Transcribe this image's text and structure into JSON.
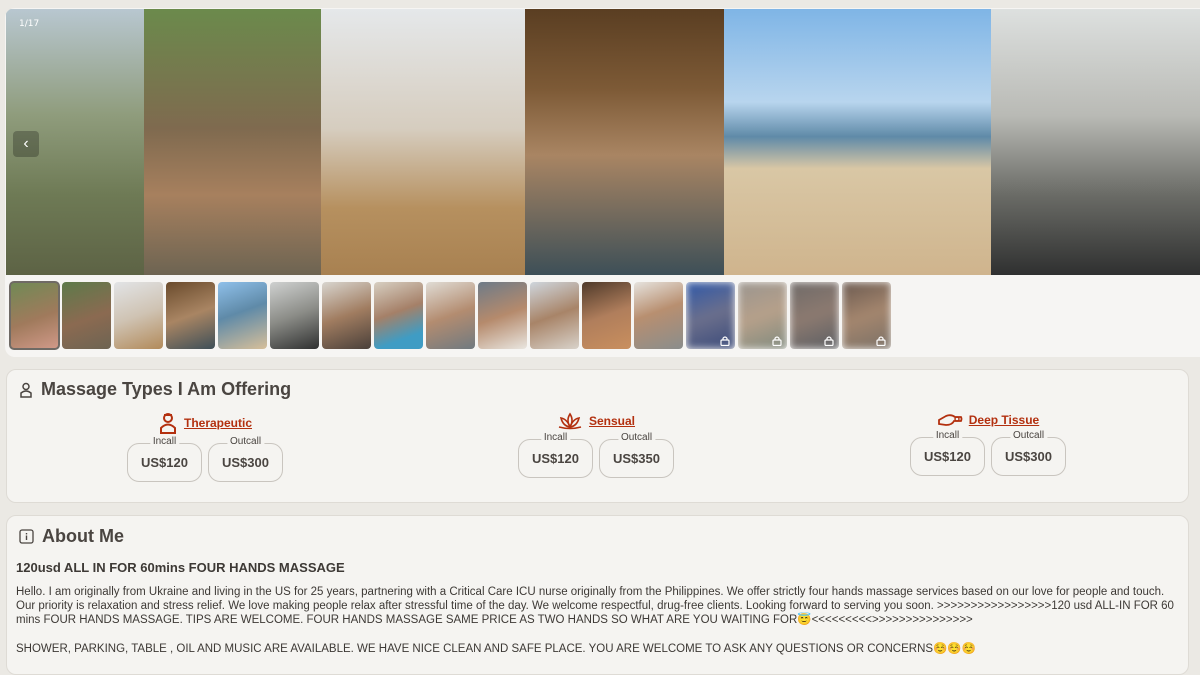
{
  "gallery": {
    "counter": "1/17",
    "prev_glyph": "‹",
    "photos": [
      {
        "bg": "linear-gradient(180deg,#b8c7d0 0%,#8f9c7c 40%,#6e7a55 70%,#5d6345 100%)",
        "w": 138
      },
      {
        "bg": "linear-gradient(180deg,#6b8a4c 0%,#7f6a4f 45%,#a7805e 70%,#6d6452 100%)",
        "w": 177
      },
      {
        "bg": "linear-gradient(180deg,#e5e8ea 0%,#d6cdbf 45%,#b6905f 75%,#a88151 100%)",
        "w": 204
      },
      {
        "bg": "linear-gradient(180deg,#5a3e22 0%,#7d5a36 30%,#a98563 55%,#3d4f57 100%)",
        "w": 199
      },
      {
        "bg": "linear-gradient(180deg,#7fb5e6 0%,#b8d5ee 35%,#5f8aa8 48%,#d9c7a5 60%,#cfb48d 100%)",
        "w": 267
      },
      {
        "bg": "linear-gradient(180deg,#dde0df 0%,#b9bab5 40%,#6a6b66 70%,#2f3030 100%)",
        "w": 209
      }
    ],
    "thumbs": [
      {
        "bg": "linear-gradient(160deg,#6f8a55,#a07a5c 55%,#d29a8a)",
        "locked": false
      },
      {
        "bg": "linear-gradient(160deg,#5d7a4a,#8b6a51 55%,#6d6452)",
        "locked": false
      },
      {
        "bg": "linear-gradient(160deg,#e2e4e6,#cfc3b3 50%,#b28a5a)",
        "locked": false
      },
      {
        "bg": "linear-gradient(160deg,#6a4b2c,#a98563 50%,#3e4f58)",
        "locked": false
      },
      {
        "bg": "linear-gradient(160deg,#8fc0ea,#5f8aa8 45%,#d7bf9a)",
        "locked": false
      },
      {
        "bg": "linear-gradient(160deg,#cfd1d0,#8b8c87 50%,#2f3030)",
        "locked": false
      },
      {
        "bg": "linear-gradient(160deg,#d8d5cf,#a07c60 50%,#4a403a)",
        "locked": false
      },
      {
        "bg": "linear-gradient(160deg,#d7cfc2,#a58068 45%,#3f9cc4 80%)",
        "locked": false
      },
      {
        "bg": "linear-gradient(160deg,#e0dcd5,#b38c70 50%,#707a80)",
        "locked": false
      },
      {
        "bg": "linear-gradient(160deg,#6e7b88,#b58a6c 50%,#e9e6e0)",
        "locked": false
      },
      {
        "bg": "linear-gradient(160deg,#cfd6dd,#a88468 50%,#d8d2ca)",
        "locked": false
      },
      {
        "bg": "linear-gradient(160deg,#4f3a2a,#b07e5c 50%,#c98f5e)",
        "locked": false
      },
      {
        "bg": "linear-gradient(160deg,#e6e3de,#b88f70 45%,#8a8d8c)",
        "locked": false
      },
      {
        "bg": "linear-gradient(160deg,#2f58a8,#6b6f8c 50%,#3a4a7a)",
        "locked": true
      },
      {
        "bg": "linear-gradient(160deg,#9a958f,#b6a08a 50%,#7f8a7e)",
        "locked": true
      },
      {
        "bg": "linear-gradient(160deg,#6f6a68,#8c7a70 50%,#5b5e63)",
        "locked": true
      },
      {
        "bg": "linear-gradient(160deg,#6b5a50,#a4866e 50%,#7a7066)",
        "locked": true
      }
    ]
  },
  "massage": {
    "title": "Massage Types I Am Offering",
    "accent": "#b3300f",
    "types": [
      {
        "name": "Therapeutic",
        "icon": "therapist-icon",
        "incall_label": "Incall",
        "incall": "US$120",
        "outcall_label": "Outcall",
        "outcall": "US$300"
      },
      {
        "name": "Sensual",
        "icon": "lotus-icon",
        "incall_label": "Incall",
        "incall": "US$120",
        "outcall_label": "Outcall",
        "outcall": "US$350"
      },
      {
        "name": "Deep Tissue",
        "icon": "hand-massage-icon",
        "incall_label": "Incall",
        "incall": "US$120",
        "outcall_label": "Outcall",
        "outcall": "US$300"
      }
    ]
  },
  "about": {
    "title": "About Me",
    "headline": "120usd ALL IN FOR 60mins FOUR HANDS MASSAGE",
    "paragraph": "Hello. I am originally from Ukraine and living in the US for 25 years, partnering with a Critical Care ICU nurse originally from the Philippines. We offer strictly four hands massage services based on our love for people and touch. Our priority is relaxation and stress relief. We love making people relax after stressful time of the day. We welcome respectful, drug-free clients. Looking forward to serving you soon. >>>>>>>>>>>>>>>>>120 usd ALL-IN FOR 60 mins FOUR HANDS MASSAGE. TIPS ARE WELCOME. FOUR HANDS MASSAGE SAME PRICE AS TWO HANDS SO WHAT ARE YOU WAITING FOR😇<<<<<<<<<>>>>>>>>>>>>>>>",
    "paragraph2": "SHOWER, PARKING, TABLE , OIL AND MUSIC ARE AVAILABLE. WE HAVE NICE CLEAN AND SAFE PLACE. YOU ARE WELCOME TO ASK ANY QUESTIONS OR CONCERNS☺️☺️☺️"
  }
}
